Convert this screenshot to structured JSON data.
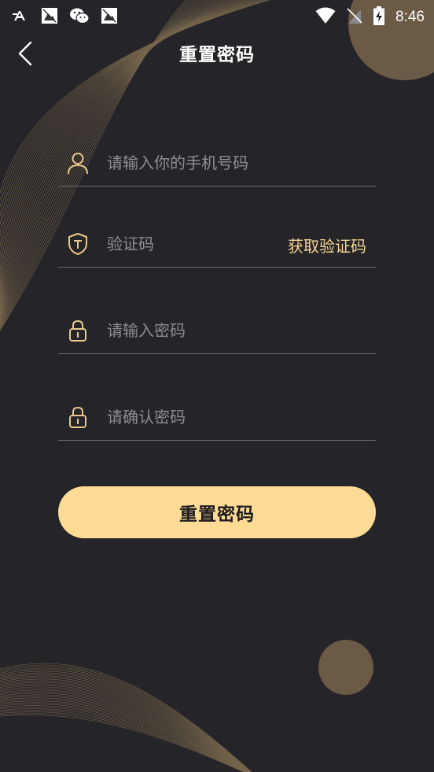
{
  "status_bar": {
    "time": "8:46",
    "left_icons": [
      "font-app-icon",
      "image-icon",
      "wechat-icon",
      "image-icon"
    ],
    "right_icons": [
      "wifi-icon",
      "no-signal-icon",
      "battery-charging-icon"
    ]
  },
  "header": {
    "title": "重置密码"
  },
  "form": {
    "phone": {
      "value": "",
      "placeholder": "请输入你的手机号码"
    },
    "code": {
      "value": "",
      "placeholder": "验证码",
      "get_code_label": "获取验证码"
    },
    "password": {
      "value": "",
      "placeholder": "请输入密码"
    },
    "confirm_password": {
      "value": "",
      "placeholder": "请确认密码"
    }
  },
  "submit_label": "重置密码",
  "colors": {
    "background": "#252428",
    "accent": "#fddb94",
    "accent_text": "#f5d48e",
    "icon": "#e8c88a",
    "divider": "#6e6c70",
    "placeholder": "#8f8d92",
    "decor_circle": "#6b5a46"
  }
}
